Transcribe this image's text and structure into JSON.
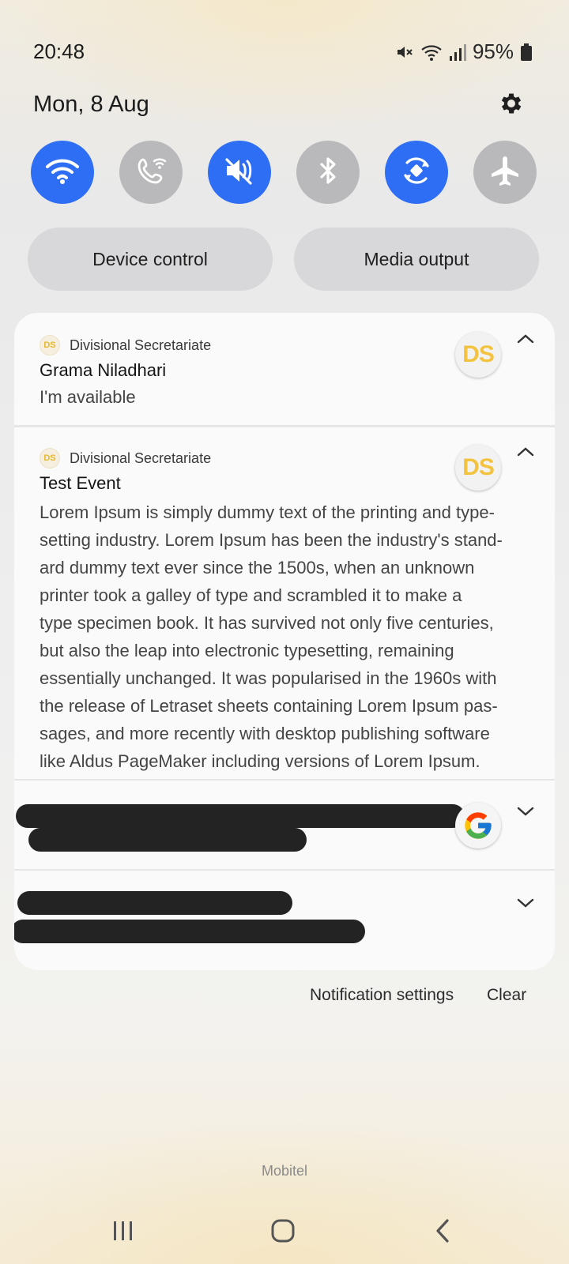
{
  "status_bar": {
    "time": "20:48",
    "battery": "95%"
  },
  "header": {
    "date": "Mon, 8 Aug"
  },
  "quick_toggles": [
    {
      "name": "wifi",
      "state": "on"
    },
    {
      "name": "wifi-calling",
      "state": "off"
    },
    {
      "name": "sound-mute",
      "state": "on"
    },
    {
      "name": "bluetooth",
      "state": "off"
    },
    {
      "name": "auto-rotate",
      "state": "on"
    },
    {
      "name": "airplane-mode",
      "state": "off"
    }
  ],
  "controls": {
    "device_control": "Device control",
    "media_output": "Media output"
  },
  "notifications": [
    {
      "app": "Divisional Secretariate",
      "app_badge": "DS",
      "title": "Grama Niladhari",
      "text": "I'm available"
    },
    {
      "app": "Divisional Secretariate",
      "app_badge": "DS",
      "title": "Test Event",
      "body_lines": [
        "Lorem Ipsum is simply dummy text of the printing and type-",
        "setting industry. Lorem Ipsum has been the industry's stand-",
        "ard dummy text ever since the 1500s, when an unknown",
        "printer took a galley of type and scrambled it to make a",
        "type specimen book. It has survived not only five centuries,",
        "but also the leap into electronic typesetting, remaining",
        "essentially unchanged. It was popularised in the 1960s with",
        "the release of Letraset sheets containing Lorem Ipsum pas-",
        "sages, and more recently with desktop publishing software",
        "like Aldus PageMaker including versions of Lorem Ipsum."
      ]
    }
  ],
  "footer_actions": {
    "notification_settings": "Notification settings",
    "clear": "Clear"
  },
  "carrier": "Mobitel",
  "colors": {
    "toggle_on": "#2e6ef5",
    "toggle_off": "#b9b9bb",
    "ds_badge": "#f3c23f"
  }
}
